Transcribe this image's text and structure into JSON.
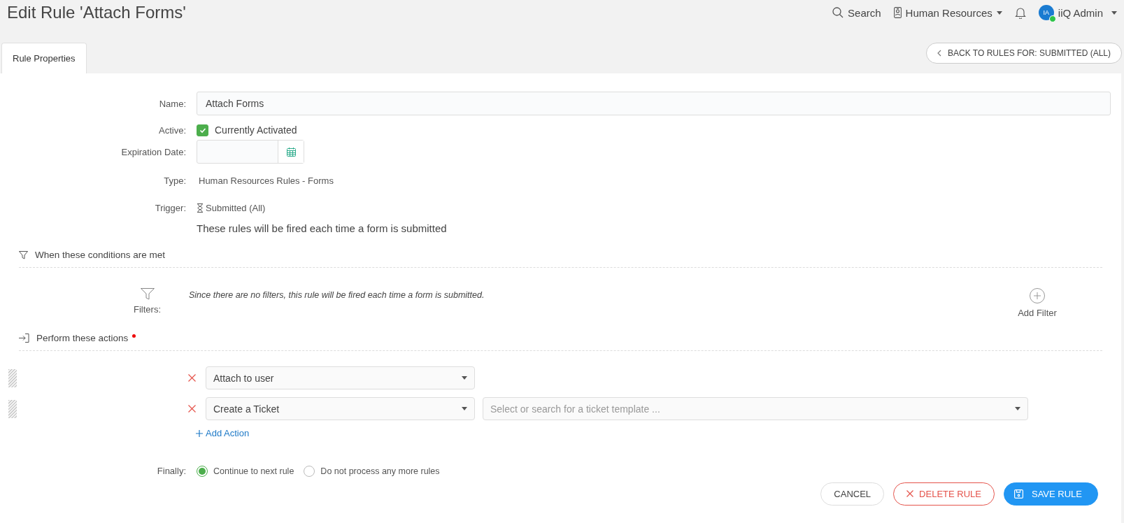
{
  "header": {
    "title": "Edit Rule 'Attach Forms'",
    "search_label": "Search",
    "department": "Human Resources",
    "user_initials": "IA",
    "user_name": "iiQ Admin"
  },
  "tabs": [
    {
      "label": "Rule Properties",
      "selected": true
    }
  ],
  "back_button": "BACK TO RULES FOR: SUBMITTED (ALL)",
  "form": {
    "name": {
      "label": "Name:",
      "value": "Attach Forms"
    },
    "active": {
      "label": "Active:",
      "checked": true,
      "text": "Currently Activated"
    },
    "expiration": {
      "label": "Expiration Date:"
    },
    "type": {
      "label": "Type:",
      "value": "Human Resources Rules - Forms"
    },
    "trigger": {
      "label": "Trigger:",
      "value": "Submitted (All)",
      "description": "These rules will be fired each time a form is submitted"
    }
  },
  "conditions": {
    "title": "When these conditions are met",
    "filters_label": "Filters:",
    "empty_message": "Since there are no filters, this rule will be fired each time a form is submitted.",
    "add_filter": "Add Filter"
  },
  "actions": {
    "title": "Perform these actions",
    "required": true,
    "items": [
      {
        "value": "Attach to user"
      },
      {
        "value": "Create a Ticket",
        "template_placeholder": "Select or search for a ticket template ..."
      }
    ],
    "add_action": "Add Action"
  },
  "finally": {
    "label": "Finally:",
    "options": [
      {
        "label": "Continue to next rule",
        "selected": true
      },
      {
        "label": "Do not process any more rules",
        "selected": false
      }
    ]
  },
  "buttons": [
    {
      "kind": "secondary",
      "label": "CANCEL"
    },
    {
      "kind": "danger",
      "label": "DELETE RULE"
    },
    {
      "kind": "primary",
      "label": "SAVE RULE"
    }
  ]
}
